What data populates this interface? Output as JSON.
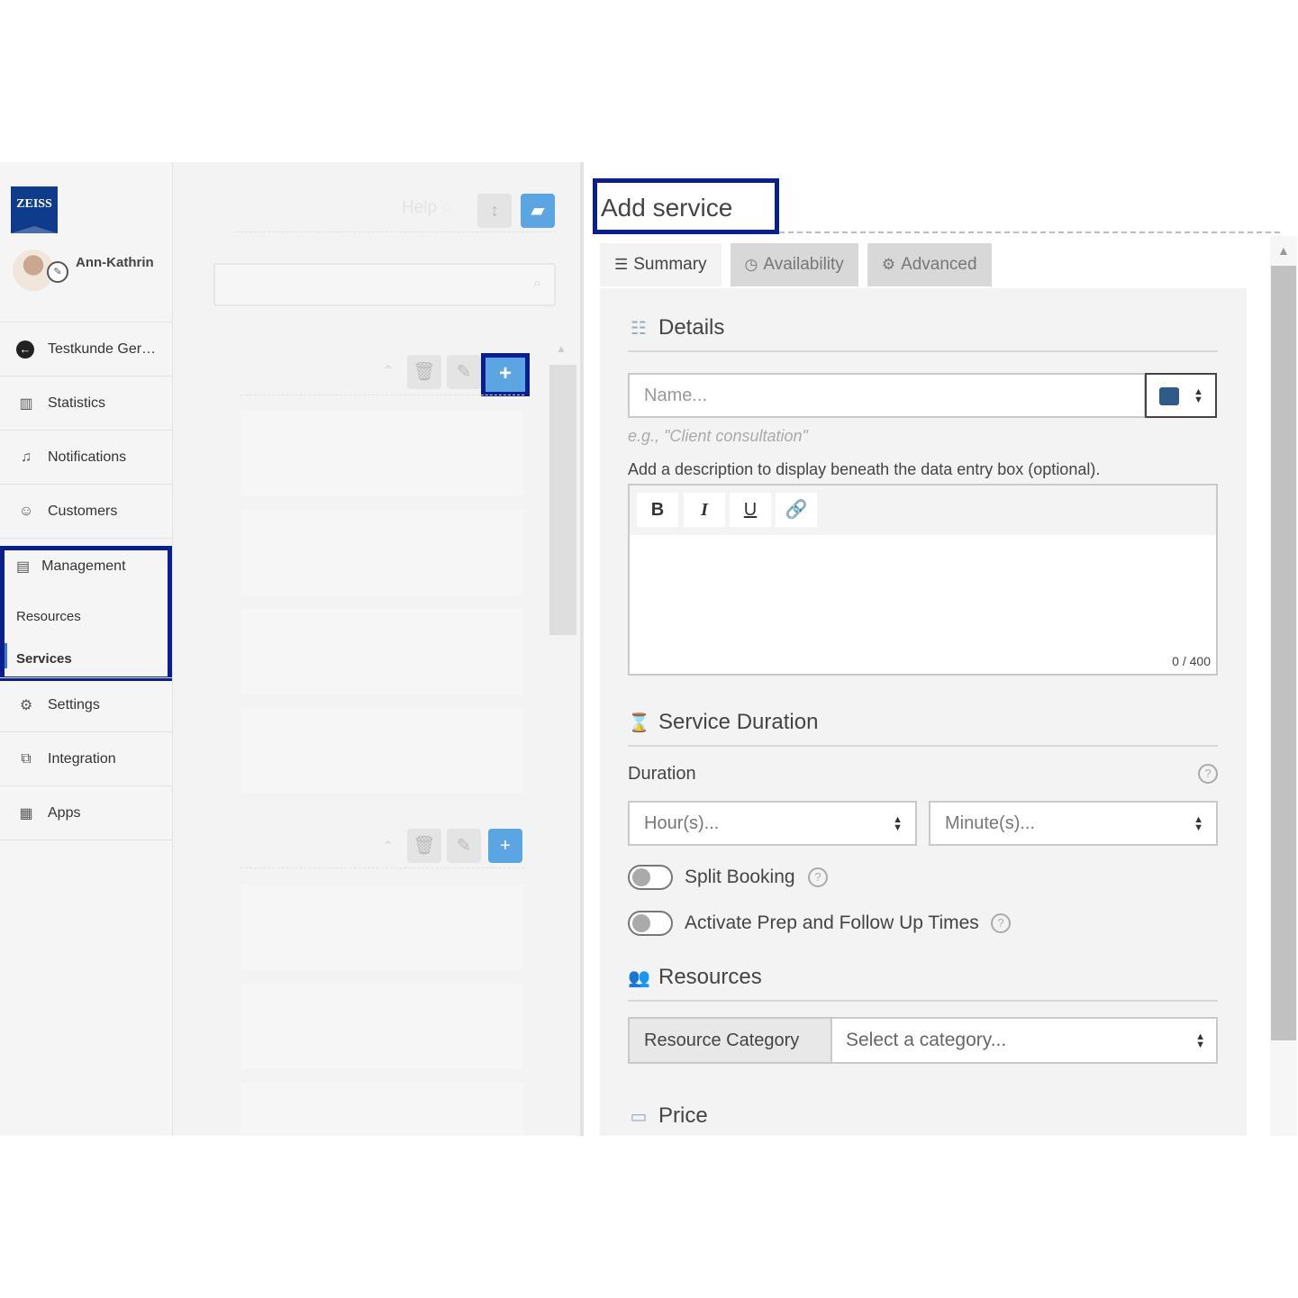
{
  "brand": {
    "logo_text": "ZEISS",
    "accent": "#0a1f8f",
    "primary_blue": "#5aa5e2"
  },
  "user": {
    "name": "Ann-Kathrin"
  },
  "sidebar": {
    "account": "Testkunde Ger…",
    "items": [
      {
        "label": "Statistics",
        "icon": "bar-chart-icon"
      },
      {
        "label": "Notifications",
        "icon": "bell-icon"
      },
      {
        "label": "Customers",
        "icon": "user-icon"
      }
    ],
    "management": {
      "label": "Management",
      "sub": [
        "Resources",
        "Services"
      ],
      "active": "Services"
    },
    "bottom_items": [
      {
        "label": "Settings",
        "icon": "gears-icon"
      },
      {
        "label": "Integration",
        "icon": "puzzle-icon"
      },
      {
        "label": "Apps",
        "icon": "grid-icon"
      }
    ]
  },
  "list": {
    "help": "Help"
  },
  "panel": {
    "title": "Add service",
    "tabs": [
      "Summary",
      "Availability",
      "Advanced"
    ],
    "details": {
      "heading": "Details",
      "name_placeholder": "Name...",
      "color": "#2f5b8c",
      "hint": "e.g., \"Client consultation\"",
      "desc_label": "Add a description to display beneath the data entry box (optional).",
      "toolbar": [
        "B",
        "I",
        "U"
      ],
      "counter": "0 / 400"
    },
    "duration": {
      "heading": "Service Duration",
      "label": "Duration",
      "hours": "Hour(s)...",
      "minutes": "Minute(s)...",
      "split": "Split Booking",
      "prep": "Activate Prep and Follow Up Times"
    },
    "resources": {
      "heading": "Resources",
      "addon": "Resource Category",
      "select": "Select a category..."
    },
    "price": {
      "heading": "Price"
    }
  }
}
